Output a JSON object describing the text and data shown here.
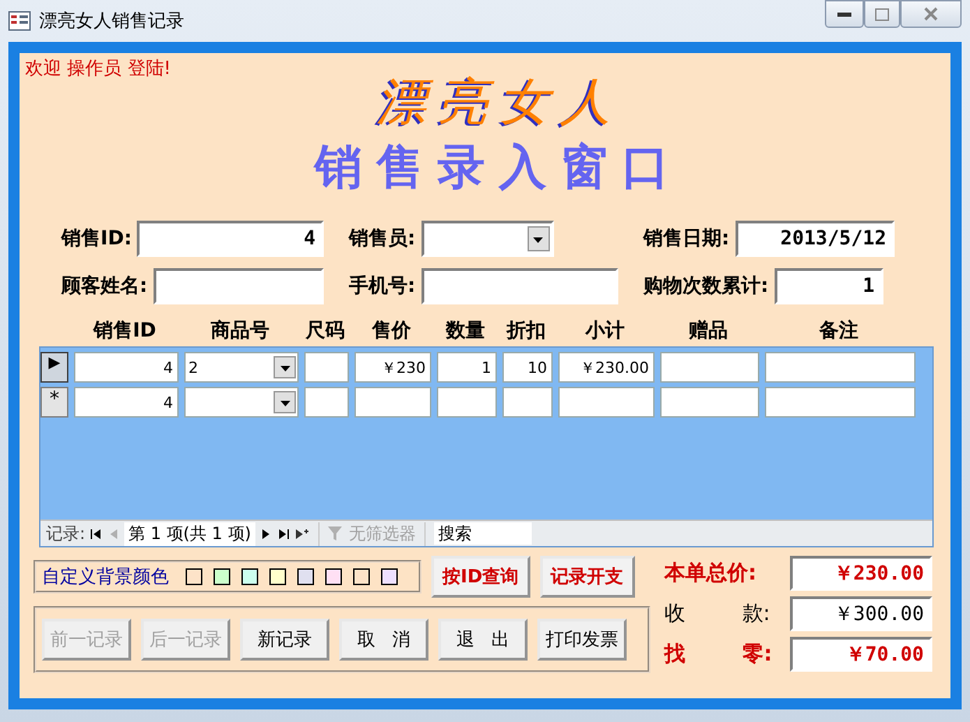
{
  "window": {
    "title": "漂亮女人销售记录"
  },
  "welcome": "欢迎 操作员 登陆!",
  "logo": "漂亮女人",
  "heading": "销售录入窗口",
  "field_rows": [
    {
      "fields": [
        {
          "label": "销售ID:",
          "kind": "text",
          "value": "4"
        },
        {
          "label": "销售员:",
          "kind": "combo"
        },
        {
          "label": "销售日期:",
          "kind": "text",
          "value": "2013/5/12"
        }
      ]
    },
    {
      "fields": [
        {
          "label": "顾客姓名:",
          "kind": "text"
        },
        {
          "label": "手机号:",
          "kind": "text"
        },
        {
          "label": "购物次数累计:",
          "kind": "text",
          "value": "1"
        }
      ]
    }
  ],
  "grid": {
    "columns": [
      "销售ID",
      "商品号",
      "尺码",
      "售价",
      "数量",
      "折扣",
      "小计",
      "赠品",
      "备注"
    ],
    "rows": [
      {
        "marker": "▶",
        "selected": true,
        "cells": {
          "sale_id": "4",
          "product": "2",
          "price": "￥230",
          "quantity": "1",
          "discount": "10",
          "subtotal": "￥230.00"
        }
      },
      {
        "marker": "*",
        "selected": false,
        "cells": {
          "sale_id": "4"
        }
      }
    ],
    "navigator": {
      "label": "记录:",
      "position": "第 1 项(共 1 项)",
      "filter": "无筛选器",
      "search_placeholder": "搜索"
    }
  },
  "color_picker": {
    "label": "自定义背景颜色",
    "swatches": [
      {
        "color": "#fde3c8"
      },
      {
        "color": "#ccffcc"
      },
      {
        "color": "#ccffee"
      },
      {
        "color": "#ffffcc"
      },
      {
        "color": "#e0e0f0"
      },
      {
        "color": "#ffe0f4"
      },
      {
        "color": "#fde3c8"
      },
      {
        "color": "#eee0ff"
      }
    ]
  },
  "query_buttons": [
    "按ID查询",
    "记录开支"
  ],
  "buttons": [
    {
      "label": "前一记录",
      "disabled": true
    },
    {
      "label": "后一记录",
      "disabled": true
    },
    {
      "label": "新记录",
      "disabled": false
    },
    {
      "label": "取 消",
      "disabled": false
    },
    {
      "label": "退 出",
      "disabled": false
    },
    {
      "label": "打印发票",
      "disabled": false
    }
  ],
  "totals": [
    {
      "label": "本单总价:",
      "value": "￥230.00",
      "emphasis": true
    },
    {
      "label": "收 款:",
      "value": "￥300.00",
      "emphasis": false
    },
    {
      "label": "找 零:",
      "value": "￥70.00",
      "emphasis": true
    }
  ]
}
